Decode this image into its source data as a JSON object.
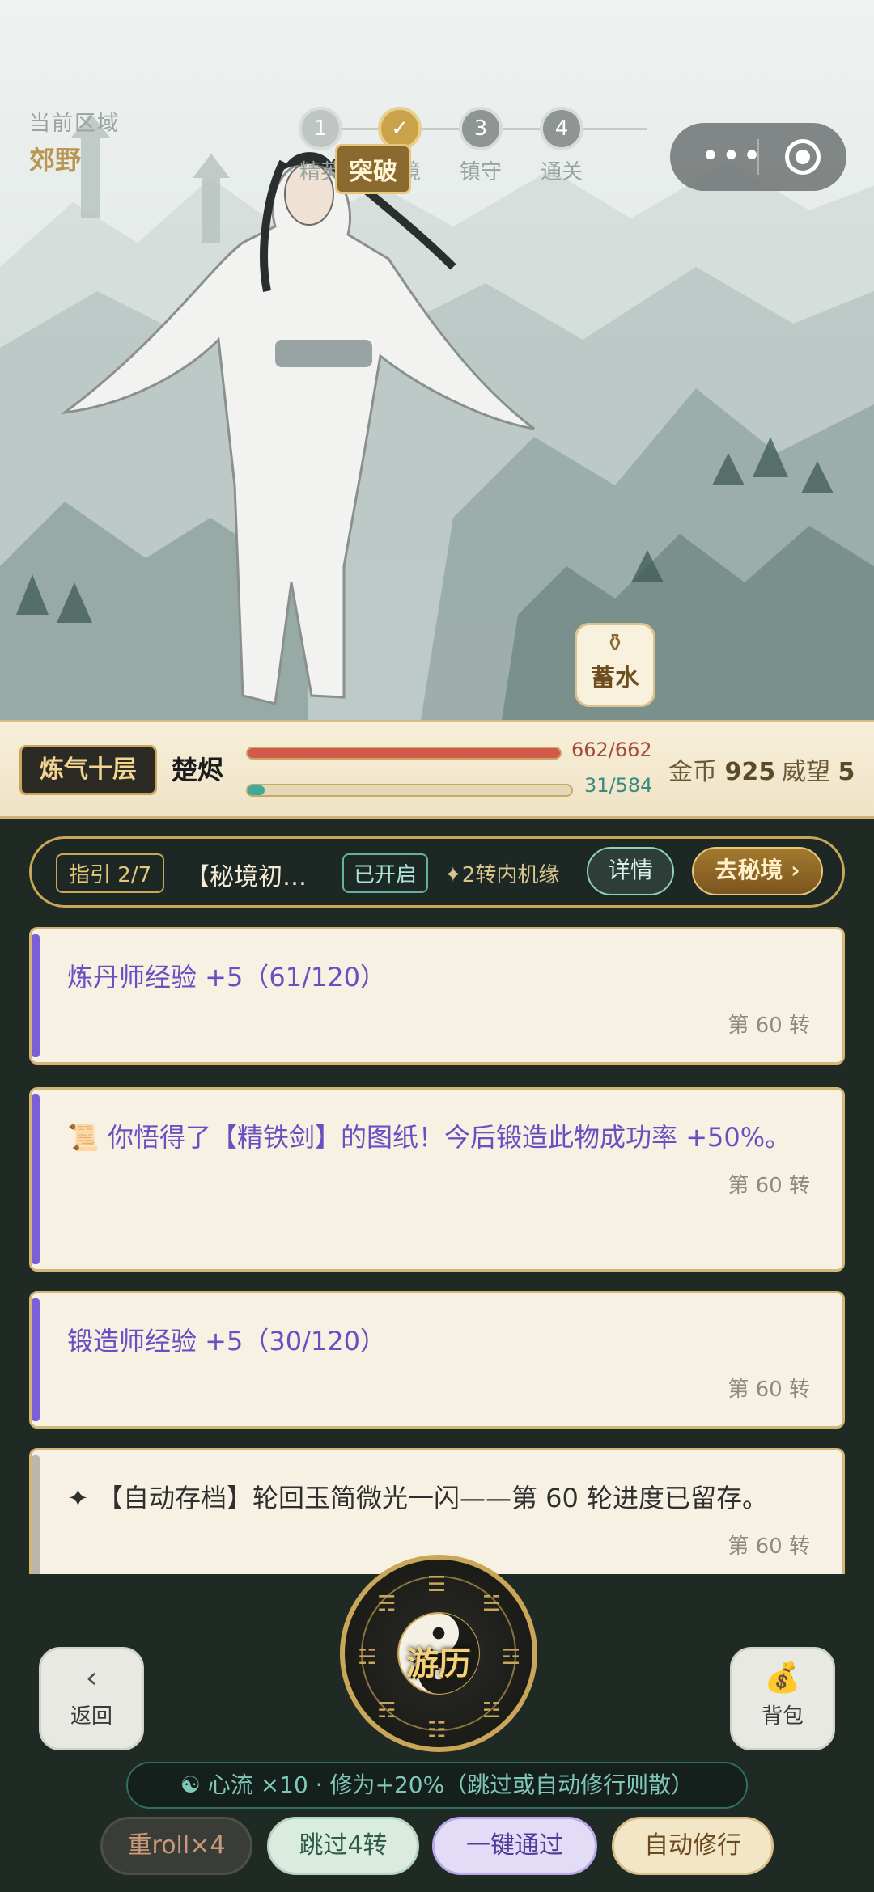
{
  "region": {
    "label": "当前区域",
    "name": "郊野"
  },
  "stages": [
    {
      "num": "1",
      "label": "精英",
      "state": "done"
    },
    {
      "num": "✓",
      "label": "秘境",
      "state": "active"
    },
    {
      "num": "3",
      "label": "镇守",
      "state": "todo"
    },
    {
      "num": "4",
      "label": "通关",
      "state": "todo"
    }
  ],
  "stage_badge": "突破",
  "capsule": {
    "more": "•••",
    "target": "target-icon"
  },
  "xushui": {
    "icon": "vase-icon",
    "label": "蓄水"
  },
  "player": {
    "realm": "炼气十层",
    "name": "楚烬",
    "hp": {
      "text": "662/662",
      "value": 662,
      "max": 662
    },
    "mp": {
      "text": "31/584",
      "value": 31,
      "max": 584
    },
    "gold_label": "金币",
    "gold": "925",
    "prestige_label": "威望",
    "prestige": "5"
  },
  "guide": {
    "step": "指引 2/7",
    "title": "【秘境初…",
    "status": "已开启",
    "chance": "✦2转内机缘",
    "detail": "详情",
    "go": "去秘境 ›"
  },
  "log": [
    {
      "text": "炼丹师经验 +5（61/120）",
      "turn": "第 60 转",
      "style": "purple"
    },
    {
      "text": "📜 你悟得了【精铁剑】的图纸！今后锻造此物成功率 +50%。",
      "turn": "第 60 转",
      "style": "purple"
    },
    {
      "text": "锻造师经验 +5（30/120）",
      "turn": "第 60 转",
      "style": "purple"
    },
    {
      "text": "✦ 【自动存档】轮回玉简微光一闪——第 60 轮进度已留存。",
      "turn": "第 60 转",
      "style": "gray"
    }
  ],
  "controls": {
    "back_icon": "‹",
    "back": "返回",
    "travel": "游历",
    "bag_icon": "💰",
    "bag": "背包",
    "flow": "☯ 心流 ×10 · 修为+20%（跳过或自动修行则散）",
    "reroll": "重roll×4",
    "skip": "跳过4转",
    "pass": "一键通过",
    "auto": "自动修行"
  }
}
